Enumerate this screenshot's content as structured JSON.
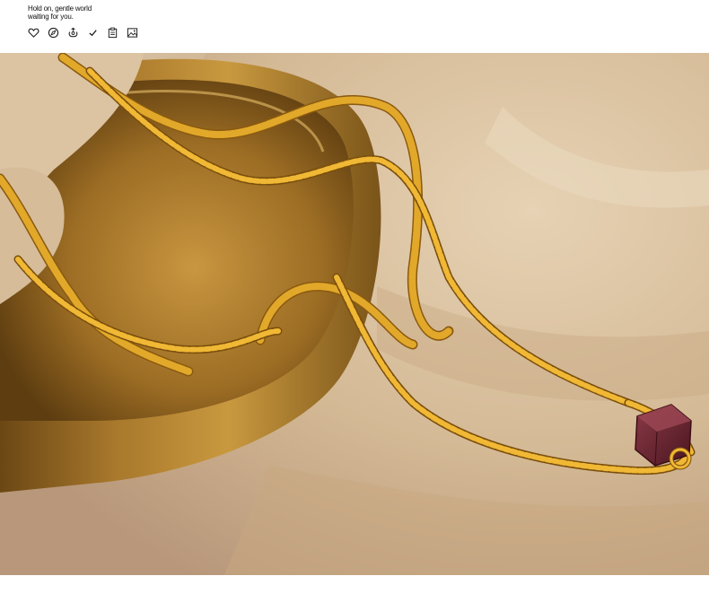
{
  "header": {
    "tagline_line1": "Hold on, gentle world",
    "tagline_line2": "waiting for you."
  },
  "icons": [
    {
      "name": "heart-icon"
    },
    {
      "name": "compass-icon"
    },
    {
      "name": "recycle-icon"
    },
    {
      "name": "check-icon"
    },
    {
      "name": "clipboard-icon"
    },
    {
      "name": "image-icon"
    }
  ],
  "colors": {
    "fabric": "#d9c1a0",
    "brass": "#a8782c",
    "gold_chain": "#e0a526",
    "gem": "#6b2530"
  }
}
